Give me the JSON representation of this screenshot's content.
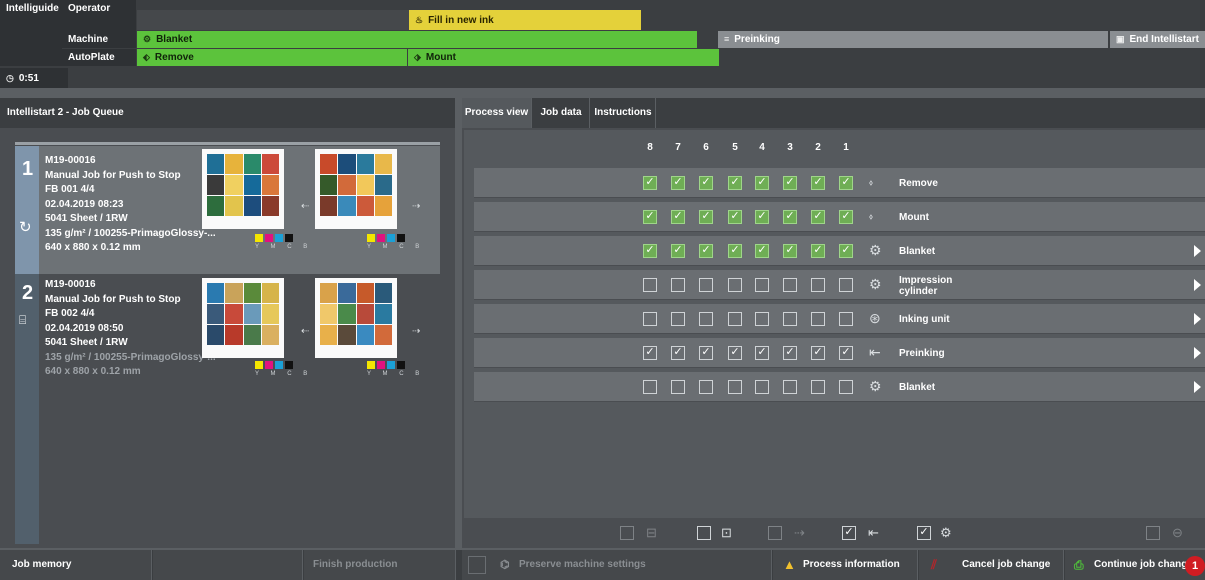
{
  "guide": {
    "title": "Intelliguide",
    "timer": "0:51",
    "rows": [
      {
        "label": "Operator"
      },
      {
        "label": "Machine"
      },
      {
        "label": "AutoPlate"
      }
    ],
    "operator_step": "Fill in new ink",
    "machine_step": "Blanket",
    "machine_next": "Preinking",
    "end_label": "End Intellistart",
    "autoplate_step1": "Remove",
    "autoplate_step2": "Mount"
  },
  "queue": {
    "title": "Intellistart 2 - Job Queue",
    "jobs": [
      {
        "num": "1",
        "id": "M19-00016",
        "name": "Manual Job for Push to Stop",
        "fb": "FB 001  4/4",
        "date": "02.04.2019 08:23",
        "sheet": "5041 Sheet / 1RW",
        "paper": "135 g/m²  /  100255-PrimagoGlossy-...",
        "size": "640 x 880 x 0.12 mm"
      },
      {
        "num": "2",
        "id": "M19-00016",
        "name": "Manual Job for Push to Stop",
        "fb": "FB 002  4/4",
        "date": "02.04.2019 08:50",
        "sheet": "5041 Sheet / 1RW",
        "paper": "135 g/m²  /  100255-PrimagoGlossy-...",
        "size": "640 x 880 x 0.12 mm"
      }
    ],
    "cmyk_label": "Y M C B"
  },
  "tabs": [
    "Process view",
    "Job data",
    "Instructions"
  ],
  "process": {
    "columns": [
      "8",
      "7",
      "6",
      "5",
      "4",
      "3",
      "2",
      "1"
    ],
    "rows": [
      {
        "label": "Remove",
        "state": "green",
        "arrow": false,
        "icon": "remove-plate-icon",
        "glyph": "⬫"
      },
      {
        "label": "Mount",
        "state": "green",
        "arrow": false,
        "icon": "mount-plate-icon",
        "glyph": "⬫"
      },
      {
        "label": "Blanket",
        "state": "green",
        "arrow": true,
        "icon": "blanket-wash-icon",
        "glyph": "⚙"
      },
      {
        "label": "Impression cylinder",
        "state": "empty",
        "arrow": true,
        "icon": "impression-cylinder-icon",
        "glyph": "⚙"
      },
      {
        "label": "Inking unit",
        "state": "empty",
        "arrow": true,
        "icon": "inking-unit-icon",
        "glyph": "⊛"
      },
      {
        "label": "Preinking",
        "state": "checked",
        "arrow": true,
        "icon": "preinking-icon",
        "glyph": "⇤"
      },
      {
        "label": "Blanket",
        "state": "empty",
        "arrow": true,
        "icon": "blanket-icon",
        "glyph": "⚙"
      }
    ]
  },
  "bottom": {
    "job_memory": "Job memory",
    "finish_production": "Finish production",
    "preserve": "Preserve machine settings",
    "process_info": "Process information",
    "cancel": "Cancel job change",
    "continue": "Continue job change",
    "badge": "1"
  },
  "colors": {
    "green": "#5cc33c",
    "yellow": "#e4d13a",
    "badge": "#d01c22"
  }
}
